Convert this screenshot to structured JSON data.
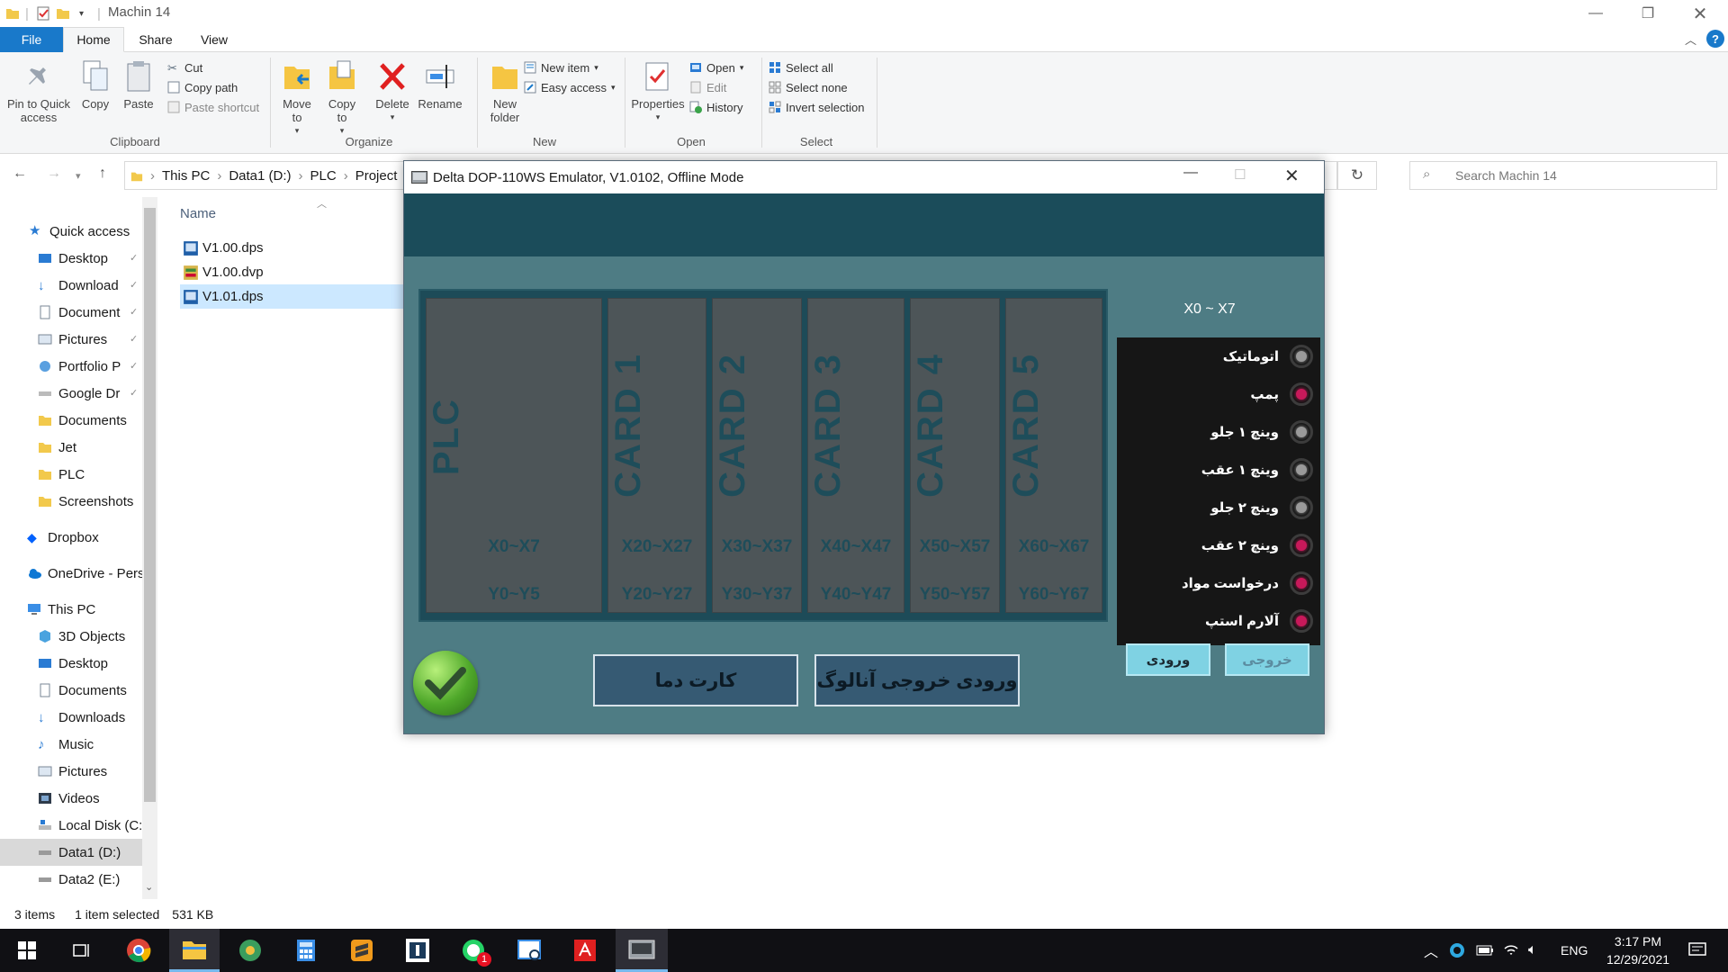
{
  "titlebar": {
    "title": "Machin 14"
  },
  "ribbon_tabs": {
    "file": "File",
    "home": "Home",
    "share": "Share",
    "view": "View"
  },
  "clipboard": {
    "pin": "Pin to Quick access",
    "copy": "Copy",
    "paste": "Paste",
    "cut": "Cut",
    "copy_path": "Copy path",
    "paste_shortcut": "Paste shortcut",
    "label": "Clipboard"
  },
  "organize": {
    "move_to": "Move to",
    "copy_to": "Copy to",
    "delete": "Delete",
    "rename": "Rename",
    "label": "Organize"
  },
  "new_group": {
    "new_folder": "New folder",
    "new_item": "New item",
    "easy_access": "Easy access",
    "label": "New"
  },
  "open_group": {
    "properties": "Properties",
    "open": "Open",
    "edit": "Edit",
    "history": "History",
    "label": "Open"
  },
  "select_group": {
    "select_all": "Select all",
    "select_none": "Select none",
    "invert": "Invert selection",
    "label": "Select"
  },
  "address": {
    "crumbs": [
      "This PC",
      "Data1 (D:)",
      "PLC",
      "Project"
    ],
    "search_placeholder": "Search Machin 14"
  },
  "nav": {
    "quick_access": "Quick access",
    "quick_items": [
      "Desktop",
      "Download",
      "Document",
      "Pictures",
      "Portfolio P",
      "Google Dr",
      "Documents",
      "Jet",
      "PLC",
      "Screenshots"
    ],
    "dropbox": "Dropbox",
    "onedrive": "OneDrive - Pers",
    "this_pc": "This PC",
    "pc_items": [
      "3D Objects",
      "Desktop",
      "Documents",
      "Downloads",
      "Music",
      "Pictures",
      "Videos",
      "Local Disk (C:",
      "Data1 (D:)",
      "Data2 (E:)"
    ]
  },
  "files": {
    "column_name": "Name",
    "items": [
      "V1.00.dps",
      "V1.00.dvp",
      "V1.01.dps"
    ]
  },
  "status": {
    "count": "3 items",
    "selected": "1 item selected",
    "size": "531 KB"
  },
  "emulator": {
    "title": "Delta DOP-110WS Emulator, V1.0102, Offline Mode",
    "slots": [
      {
        "name": "PLC",
        "x": "X0~X7",
        "y": "Y0~Y5"
      },
      {
        "name": "CARD 1",
        "x": "X20~X27",
        "y": "Y20~Y27"
      },
      {
        "name": "CARD 2",
        "x": "X30~X37",
        "y": "Y30~Y37"
      },
      {
        "name": "CARD 3",
        "x": "X40~X47",
        "y": "Y40~Y47"
      },
      {
        "name": "CARD 4",
        "x": "X50~X57",
        "y": "Y50~Y57"
      },
      {
        "name": "CARD 5",
        "x": "X60~X67",
        "y": "Y60~Y67"
      }
    ],
    "io_header": "X0 ~ X7",
    "io_items": [
      "اتوماتیک",
      "پمپ",
      "وینچ ۱ جلو",
      "وینچ ۱ عقب",
      "وینچ ۲ جلو",
      "وینچ ۲ عقب",
      "درخواست مواد",
      "آلارم استپ"
    ],
    "io_led_colors": [
      "#9a9a9a",
      "#c8195a",
      "#9a9a9a",
      "#9a9a9a",
      "#9a9a9a",
      "#c8195a",
      "#c8195a",
      "#c8195a"
    ],
    "btn_temp_card": "کارت دما",
    "btn_analog": "ورودی خروجی آنالوگ",
    "btn_input": "ورودی",
    "btn_output": "خروجی"
  },
  "taskbar": {
    "lang": "ENG",
    "time": "3:17 PM",
    "date": "12/29/2021",
    "whatsapp_badge": "1"
  },
  "colors": {
    "accent": "#1979ca",
    "emu_header": "#1b4c5a",
    "emu_body": "#4e7c84",
    "led_active": "#c8195a"
  }
}
